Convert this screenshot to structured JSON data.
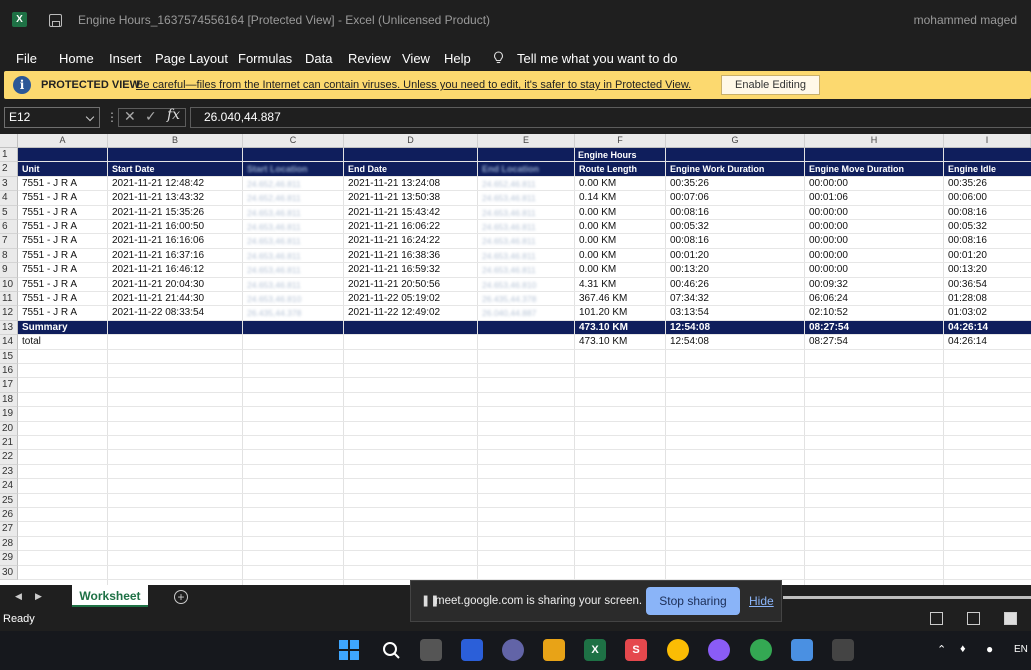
{
  "window": {
    "app_icon": "X",
    "title": "Engine Hours_1637574556164  [Protected View]  -  Excel (Unlicensed Product)",
    "user": "mohammed maged"
  },
  "menu": [
    "File",
    "Home",
    "Insert",
    "Page Layout",
    "Formulas",
    "Data",
    "Review",
    "View",
    "Help"
  ],
  "tell_me": "Tell me what you want to do",
  "protected_view": {
    "label": "PROTECTED VIEW",
    "message": "Be careful—files from the Internet can contain viruses. Unless you need to edit, it's safer to stay in Protected View.",
    "button": "Enable Editing"
  },
  "formula_bar": {
    "name_box": "E12",
    "fx": "fx",
    "value": "26.040,44.887"
  },
  "columns": [
    "A",
    "B",
    "C",
    "D",
    "E",
    "F",
    "G",
    "H",
    "I"
  ],
  "row_numbers": [
    "1",
    "2",
    "3",
    "4",
    "5",
    "6",
    "7",
    "8",
    "9",
    "10",
    "11",
    "12",
    "13",
    "14",
    "15",
    "16",
    "17",
    "18",
    "19",
    "20",
    "21",
    "22",
    "23",
    "24",
    "25",
    "26",
    "27",
    "28",
    "29",
    "30"
  ],
  "sheet": {
    "group_header": "Engine Hours",
    "headers": [
      "Unit",
      "Start Date",
      "Start Location",
      "End Date",
      "End Location",
      "Route Length",
      "Engine Work Duration",
      "Engine Move Duration",
      "Engine Idle"
    ],
    "rows": [
      [
        "7551 - J R A",
        "2021-11-21 12:48:42",
        "24.652,46.811",
        "2021-11-21 13:24:08",
        "24.652,46.811",
        "0.00 KM",
        "00:35:26",
        "00:00:00",
        "00:35:26"
      ],
      [
        "7551 - J R A",
        "2021-11-21 13:43:32",
        "24.652,46.811",
        "2021-11-21 13:50:38",
        "24.653,46.811",
        "0.14 KM",
        "00:07:06",
        "00:01:06",
        "00:06:00"
      ],
      [
        "7551 - J R A",
        "2021-11-21 15:35:26",
        "24.653,46.811",
        "2021-11-21 15:43:42",
        "24.653,46.811",
        "0.00 KM",
        "00:08:16",
        "00:00:00",
        "00:08:16"
      ],
      [
        "7551 - J R A",
        "2021-11-21 16:00:50",
        "24.653,46.811",
        "2021-11-21 16:06:22",
        "24.653,46.811",
        "0.00 KM",
        "00:05:32",
        "00:00:00",
        "00:05:32"
      ],
      [
        "7551 - J R A",
        "2021-11-21 16:16:06",
        "24.653,46.811",
        "2021-11-21 16:24:22",
        "24.653,46.811",
        "0.00 KM",
        "00:08:16",
        "00:00:00",
        "00:08:16"
      ],
      [
        "7551 - J R A",
        "2021-11-21 16:37:16",
        "24.653,46.811",
        "2021-11-21 16:38:36",
        "24.653,46.811",
        "0.00 KM",
        "00:01:20",
        "00:00:00",
        "00:01:20"
      ],
      [
        "7551 - J R A",
        "2021-11-21 16:46:12",
        "24.653,46.811",
        "2021-11-21 16:59:32",
        "24.653,46.811",
        "0.00 KM",
        "00:13:20",
        "00:00:00",
        "00:13:20"
      ],
      [
        "7551 - J R A",
        "2021-11-21 20:04:30",
        "24.653,46.811",
        "2021-11-21 20:50:56",
        "24.653,46.810",
        "4.31 KM",
        "00:46:26",
        "00:09:32",
        "00:36:54"
      ],
      [
        "7551 - J R A",
        "2021-11-21 21:44:30",
        "24.653,46.810",
        "2021-11-22 05:19:02",
        "26.435,44.378",
        "367.46 KM",
        "07:34:32",
        "06:06:24",
        "01:28:08"
      ],
      [
        "7551 - J R A",
        "2021-11-22 08:33:54",
        "26.435,44.378",
        "2021-11-22 12:49:02",
        "26.040,44.887",
        "101.20 KM",
        "03:13:54",
        "02:10:52",
        "01:03:02"
      ]
    ],
    "summary": [
      "Summary",
      "473.10 KM",
      "12:54:08",
      "08:27:54",
      "04:26:14"
    ],
    "total": [
      "total",
      "473.10 KM",
      "12:54:08",
      "08:27:54",
      "04:26:14"
    ]
  },
  "sheet_tabs": {
    "active": "Worksheet",
    "add": "+"
  },
  "status": "Ready",
  "screen_share": {
    "message": "meet.google.com is sharing your screen.",
    "stop": "Stop sharing",
    "hide": "Hide"
  },
  "taskbar": {
    "lang": "EN"
  }
}
